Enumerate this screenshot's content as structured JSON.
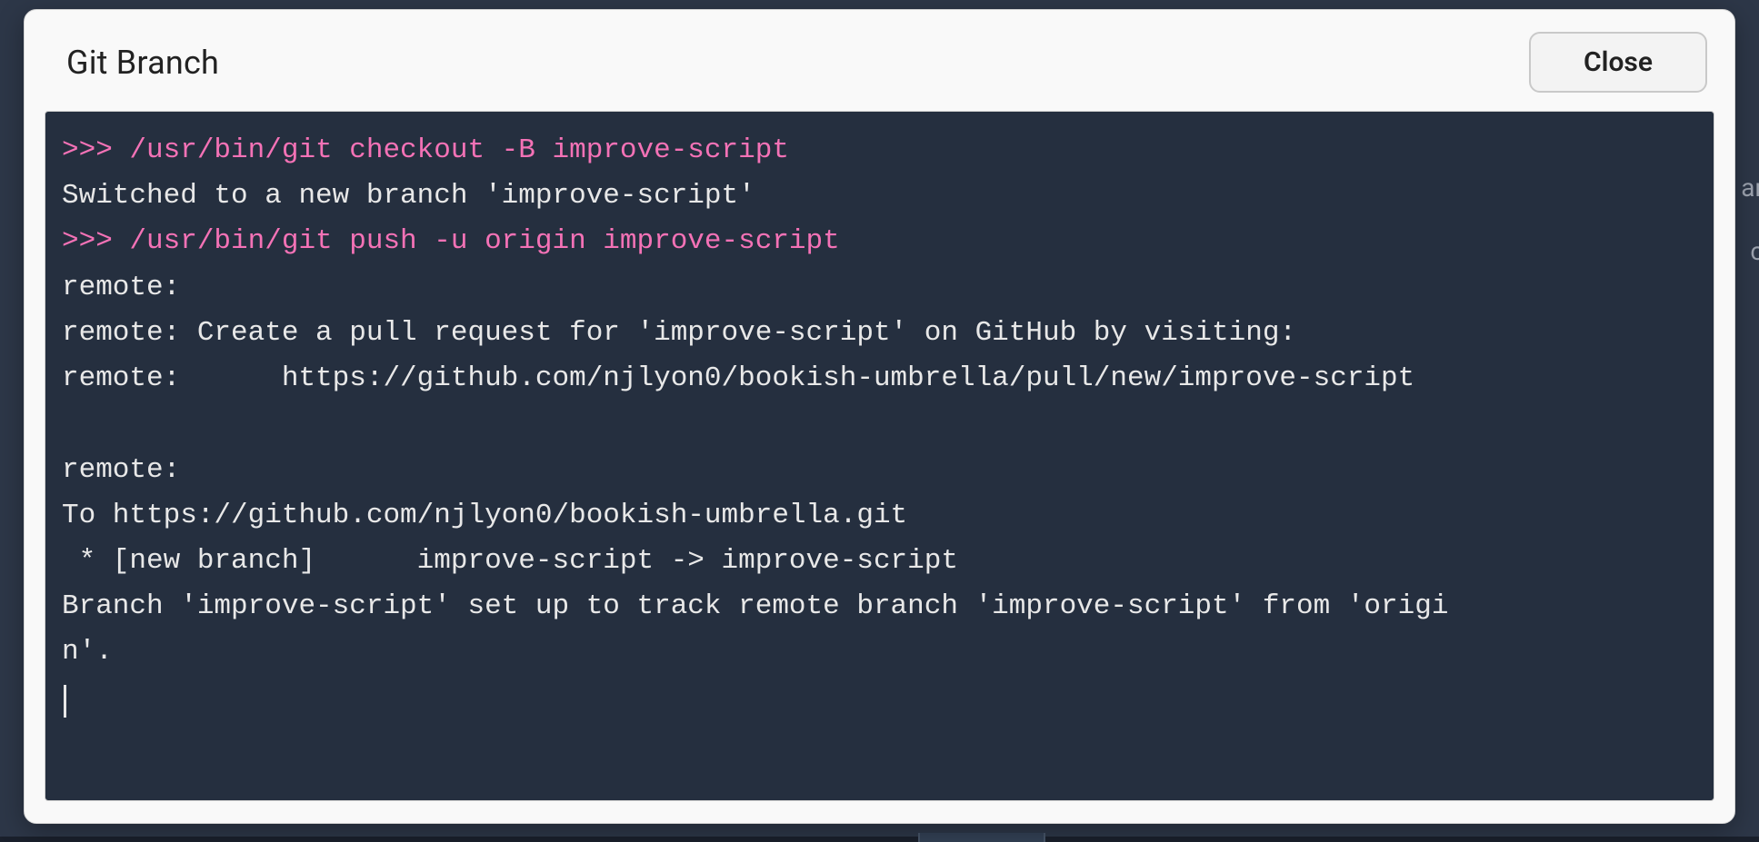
{
  "modal": {
    "title": "Git Branch",
    "close_label": "Close"
  },
  "terminal": {
    "lines": [
      {
        "type": "cmd",
        "text": ">>> /usr/bin/git checkout -B improve-script"
      },
      {
        "type": "out",
        "text": "Switched to a new branch 'improve-script'"
      },
      {
        "type": "cmd",
        "text": ">>> /usr/bin/git push -u origin improve-script"
      },
      {
        "type": "out",
        "text": "remote: "
      },
      {
        "type": "out",
        "text": "remote: Create a pull request for 'improve-script' on GitHub by visiting:"
      },
      {
        "type": "out",
        "text": "remote:      https://github.com/njlyon0/bookish-umbrella/pull/new/improve-script"
      },
      {
        "type": "out",
        "text": ""
      },
      {
        "type": "out",
        "text": "remote: "
      },
      {
        "type": "out",
        "text": "To https://github.com/njlyon0/bookish-umbrella.git"
      },
      {
        "type": "out",
        "text": " * [new branch]      improve-script -> improve-script"
      },
      {
        "type": "out",
        "text": "Branch 'improve-script' set up to track remote branch 'improve-script' from 'origi"
      },
      {
        "type": "out",
        "text": "n'."
      }
    ]
  },
  "bg": {
    "left": ";",
    "right_top": "ar",
    "right_mid": "c"
  }
}
